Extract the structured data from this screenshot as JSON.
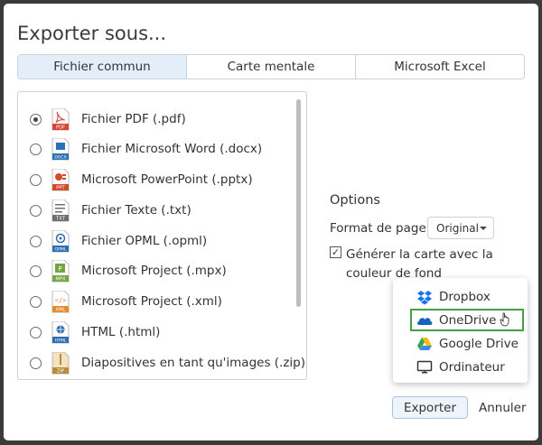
{
  "dialog": {
    "title": "Exporter sous..."
  },
  "tabs": [
    {
      "label": "Fichier commun",
      "active": true
    },
    {
      "label": "Carte mentale",
      "active": false
    },
    {
      "label": "Microsoft Excel",
      "active": false
    }
  ],
  "formats": [
    {
      "label": "Fichier PDF (.pdf)",
      "icon": "pdf-file-icon",
      "badge": "PDF",
      "selected": true
    },
    {
      "label": "Fichier Microsoft Word (.docx)",
      "icon": "docx-file-icon",
      "badge": "DOCX",
      "selected": false
    },
    {
      "label": "Microsoft PowerPoint (.pptx)",
      "icon": "ppt-file-icon",
      "badge": "PPT",
      "selected": false
    },
    {
      "label": "Fichier Texte (.txt)",
      "icon": "txt-file-icon",
      "badge": "TXT",
      "selected": false
    },
    {
      "label": "Fichier OPML (.opml)",
      "icon": "opml-file-icon",
      "badge": "OPML",
      "selected": false
    },
    {
      "label": "Microsoft Project (.mpx)",
      "icon": "mpx-file-icon",
      "badge": "MPX",
      "selected": false
    },
    {
      "label": "Microsoft Project (.xml)",
      "icon": "xml-file-icon",
      "badge": "XML",
      "selected": false
    },
    {
      "label": "HTML (.html)",
      "icon": "html-file-icon",
      "badge": "HTML",
      "selected": false
    },
    {
      "label": "Diapositives en tant qu'images (.zip)",
      "icon": "zip-file-icon",
      "badge": "ZIP",
      "selected": false
    }
  ],
  "options": {
    "title": "Options",
    "page_format_label": "Format de page",
    "page_format_value": "Original",
    "checkbox_mark": "✓",
    "generate_color_label": "Générer la carte avec la couleur de fond"
  },
  "destinations": [
    {
      "label": "Dropbox",
      "icon": "dropbox-icon"
    },
    {
      "label": "OneDrive",
      "icon": "onedrive-icon",
      "highlighted": true
    },
    {
      "label": "Google Drive",
      "icon": "google-drive-icon"
    },
    {
      "label": "Ordinateur",
      "icon": "computer-icon"
    }
  ],
  "buttons": {
    "export": "Exporter",
    "cancel": "Annuler"
  },
  "colors": {
    "pdf": "#d84436",
    "docx": "#2b6fb4",
    "ppt": "#d14a2a",
    "txt": "#707070",
    "opml": "#2f6db0",
    "mpx": "#72a443",
    "xml": "#e38a2a",
    "html": "#2f6db0",
    "zip": "#b88c3a",
    "highlight": "#43a047",
    "tab_active": "#e4eef8"
  }
}
